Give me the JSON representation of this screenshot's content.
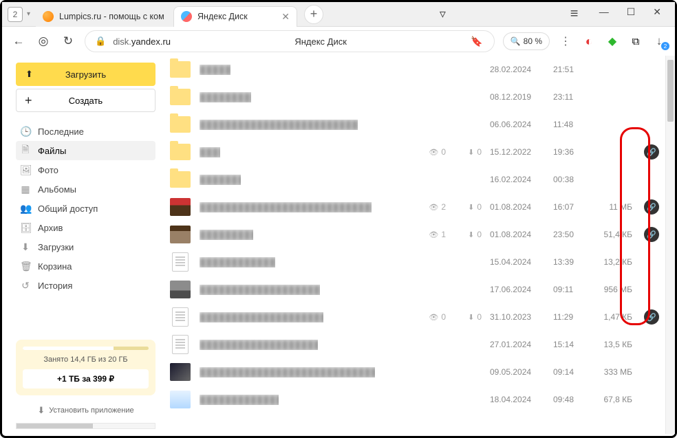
{
  "window": {
    "tab_count": "2",
    "controls": {
      "menu": "≡",
      "min": "—",
      "max": "☐",
      "close": "✕"
    }
  },
  "tabs": [
    {
      "label": "Lumpics.ru - помощь с ком"
    },
    {
      "label": "Яндекс Диск"
    }
  ],
  "newtab": "+",
  "addr": {
    "back": "←",
    "shield": "◎",
    "reload": "↻",
    "lock": "🔒",
    "url_dim": "disk.",
    "url": "yandex.ru",
    "title": "Яндекс Диск",
    "bm": "🔖",
    "zoom_ico": "🔍",
    "zoom": "80 %",
    "dots": "⋮",
    "ext_red": "◐",
    "ext_green": "◆",
    "ext_win": "⧉",
    "ext_dl": "↓",
    "dl_badge": "2"
  },
  "sidebar": {
    "upload": "Загрузить",
    "upload_ico": "⬆",
    "create": "Создать",
    "create_ico": "+",
    "nav": [
      {
        "ico": "🕒",
        "label": "Последние"
      },
      {
        "ico": "🗎",
        "label": "Файлы"
      },
      {
        "ico": "🖼",
        "label": "Фото"
      },
      {
        "ico": "▦",
        "label": "Альбомы"
      },
      {
        "ico": "👥",
        "label": "Общий доступ"
      },
      {
        "ico": "🗄",
        "label": "Архив"
      },
      {
        "ico": "⬇",
        "label": "Загрузки"
      },
      {
        "ico": "🗑",
        "label": "Корзина"
      },
      {
        "ico": "↺",
        "label": "История"
      }
    ],
    "storage_text": "Занято 14,4 ГБ из 20 ГБ",
    "storage_btn": "+1 ТБ за 399 ₽",
    "install_ico": "⬇",
    "install": "Установить приложение"
  },
  "stat_icons": {
    "view": "👁",
    "dl": "⬇"
  },
  "link_ico": "🔗",
  "files": [
    {
      "type": "folder",
      "w": "w1",
      "date": "28.02.2024",
      "time": "21:51"
    },
    {
      "type": "folder",
      "w": "w2",
      "date": "08.12.2019",
      "time": "23:11"
    },
    {
      "type": "folder",
      "w": "w3",
      "date": "06.06.2024",
      "time": "11:48"
    },
    {
      "type": "folder",
      "w": "w4",
      "views": "0",
      "dls": "0",
      "date": "15.12.2022",
      "time": "19:36",
      "link": true
    },
    {
      "type": "folder",
      "w": "w5",
      "date": "16.02.2024",
      "time": "00:38"
    },
    {
      "type": "img-a",
      "w": "w6",
      "views": "2",
      "dls": "0",
      "date": "01.08.2024",
      "time": "16:07",
      "size": "11 МБ",
      "link": true
    },
    {
      "type": "img-b",
      "w": "w7",
      "views": "1",
      "dls": "0",
      "date": "01.08.2024",
      "time": "23:50",
      "size": "51,4 КБ",
      "link": true
    },
    {
      "type": "doc",
      "w": "w8",
      "date": "15.04.2024",
      "time": "13:39",
      "size": "13,2 КБ"
    },
    {
      "type": "img-c",
      "w": "w9",
      "date": "17.06.2024",
      "time": "09:11",
      "size": "956 МБ"
    },
    {
      "type": "doc",
      "w": "w10",
      "views": "0",
      "dls": "0",
      "date": "31.10.2023",
      "time": "11:29",
      "size": "1,47 КБ",
      "link": true
    },
    {
      "type": "doc",
      "w": "w11",
      "date": "27.01.2024",
      "time": "15:14",
      "size": "13,5 КБ"
    },
    {
      "type": "img-d",
      "w": "w12",
      "date": "09.05.2024",
      "time": "09:14",
      "size": "333 МБ"
    },
    {
      "type": "img-e",
      "w": "w13",
      "date": "18.04.2024",
      "time": "09:48",
      "size": "67,8 КБ"
    }
  ]
}
